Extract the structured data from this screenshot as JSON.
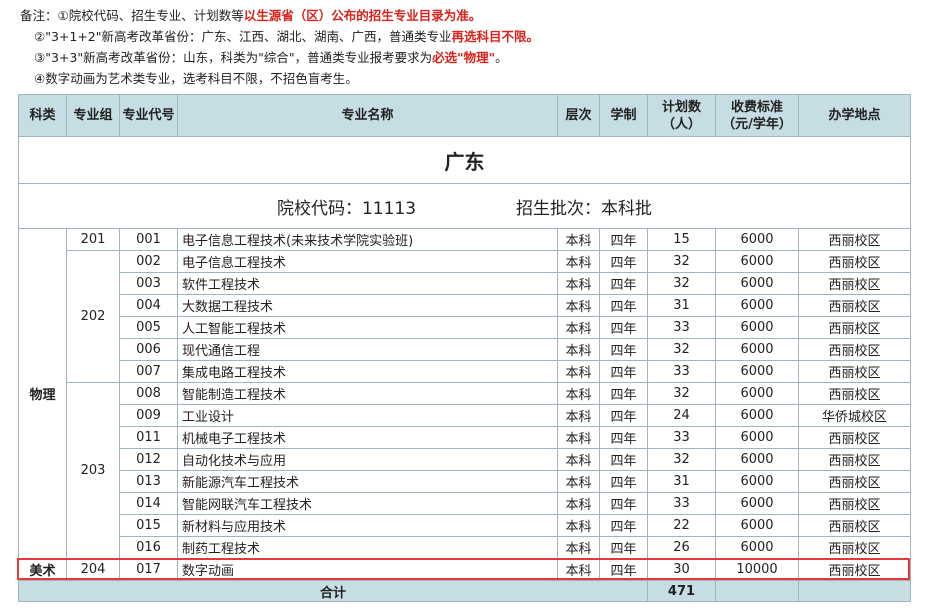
{
  "notes": {
    "line1_prefix": "备注：①院校代码、招生专业、计划数等",
    "line1_red": "以生源省（区）公布的招生专业目录为准。",
    "line2_prefix": "②\"3+1+2\"新高考改革省份：广东、江西、湖北、湖南、广西，普通类专业",
    "line2_red": "再选科目不限。",
    "line3_prefix": "③\"3+3\"新高考改革省份：山东，科类为\"综合\"，普通类专业报考要求为",
    "line3_red": "必选\"物理\"",
    "line3_suffix": "。",
    "line4": "④数字动画为艺术类专业，选考科目不限，不招色盲考生。"
  },
  "table": {
    "province": "广东",
    "school_code": "院校代码：11113",
    "batch": "招生批次：本科批",
    "headers": {
      "subject": "科类",
      "group": "专业组",
      "code": "专业代号",
      "name": "专业名称",
      "level": "层次",
      "duration": "学制",
      "plan": "计划数（人）",
      "fee": "收费标准（元/学年）",
      "campus": "办学地点"
    },
    "subjects": {
      "physics": "物理",
      "art": "美术"
    },
    "groups": {
      "g201": "201",
      "g202": "202",
      "g203": "203",
      "g204": "204"
    },
    "rows": [
      {
        "code": "001",
        "name": "电子信息工程技术(未来技术学院实验班)",
        "level": "本科",
        "duration": "四年",
        "plan": "15",
        "fee": "6000",
        "campus": "西丽校区"
      },
      {
        "code": "002",
        "name": "电子信息工程技术",
        "level": "本科",
        "duration": "四年",
        "plan": "32",
        "fee": "6000",
        "campus": "西丽校区"
      },
      {
        "code": "003",
        "name": "软件工程技术",
        "level": "本科",
        "duration": "四年",
        "plan": "32",
        "fee": "6000",
        "campus": "西丽校区"
      },
      {
        "code": "004",
        "name": "大数据工程技术",
        "level": "本科",
        "duration": "四年",
        "plan": "31",
        "fee": "6000",
        "campus": "西丽校区"
      },
      {
        "code": "005",
        "name": "人工智能工程技术",
        "level": "本科",
        "duration": "四年",
        "plan": "33",
        "fee": "6000",
        "campus": "西丽校区"
      },
      {
        "code": "006",
        "name": "现代通信工程",
        "level": "本科",
        "duration": "四年",
        "plan": "32",
        "fee": "6000",
        "campus": "西丽校区"
      },
      {
        "code": "007",
        "name": "集成电路工程技术",
        "level": "本科",
        "duration": "四年",
        "plan": "33",
        "fee": "6000",
        "campus": "西丽校区"
      },
      {
        "code": "008",
        "name": "智能制造工程技术",
        "level": "本科",
        "duration": "四年",
        "plan": "32",
        "fee": "6000",
        "campus": "西丽校区"
      },
      {
        "code": "009",
        "name": "工业设计",
        "level": "本科",
        "duration": "四年",
        "plan": "24",
        "fee": "6000",
        "campus": "华侨城校区"
      },
      {
        "code": "011",
        "name": "机械电子工程技术",
        "level": "本科",
        "duration": "四年",
        "plan": "33",
        "fee": "6000",
        "campus": "西丽校区"
      },
      {
        "code": "012",
        "name": "自动化技术与应用",
        "level": "本科",
        "duration": "四年",
        "plan": "32",
        "fee": "6000",
        "campus": "西丽校区"
      },
      {
        "code": "013",
        "name": "新能源汽车工程技术",
        "level": "本科",
        "duration": "四年",
        "plan": "31",
        "fee": "6000",
        "campus": "西丽校区"
      },
      {
        "code": "014",
        "name": "智能网联汽车工程技术",
        "level": "本科",
        "duration": "四年",
        "plan": "33",
        "fee": "6000",
        "campus": "西丽校区"
      },
      {
        "code": "015",
        "name": "新材料与应用技术",
        "level": "本科",
        "duration": "四年",
        "plan": "22",
        "fee": "6000",
        "campus": "西丽校区"
      },
      {
        "code": "016",
        "name": "制药工程技术",
        "level": "本科",
        "duration": "四年",
        "plan": "26",
        "fee": "6000",
        "campus": "西丽校区"
      },
      {
        "code": "017",
        "name": "数字动画",
        "level": "本科",
        "duration": "四年",
        "plan": "30",
        "fee": "10000",
        "campus": "西丽校区"
      }
    ],
    "total_label": "合计",
    "total_value": "471"
  }
}
